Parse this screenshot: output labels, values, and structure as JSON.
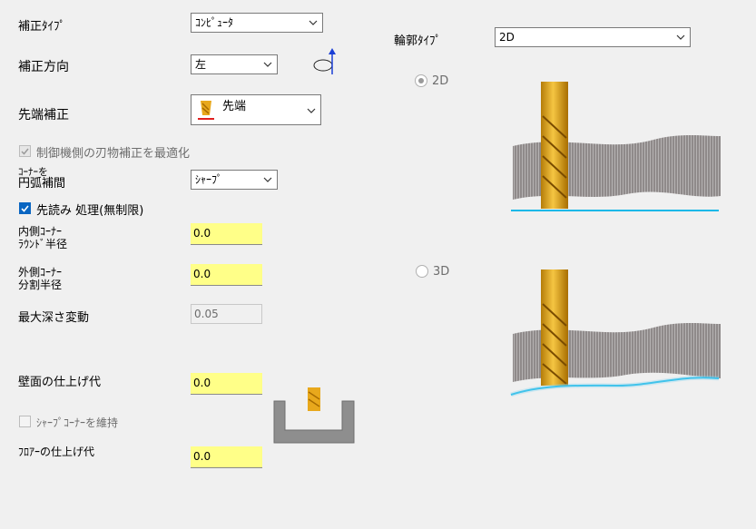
{
  "correction_type": {
    "label": "補正ﾀｲﾌﾟ",
    "value": "ｺﾝﾋﾟｭｰﾀ"
  },
  "correction_direction": {
    "label": "補正方向",
    "value": "左"
  },
  "tip_correction": {
    "label": "先端補正",
    "value": "先端"
  },
  "optimize_wear": {
    "label": "制御機側の刃物補正を最適化",
    "checked": true,
    "disabled": true
  },
  "corner_arc": {
    "label_line1": "ｺｰﾅｰを",
    "label_line2": "円弧補間",
    "value": "ｼｬｰﾌﾟ"
  },
  "lookahead": {
    "label": "先読み 処理(無制限)",
    "checked": true
  },
  "inner_corner": {
    "label_line1": "内側ｺｰﾅｰ",
    "label_line2": "ﾗｳﾝﾄﾞ半径",
    "value": "0.0"
  },
  "outer_corner": {
    "label_line1": "外側ｺｰﾅｰ",
    "label_line2": "分割半径",
    "value": "0.0"
  },
  "max_depth_variation": {
    "label": "最大深さ変動",
    "value": "0.05"
  },
  "wall_stock": {
    "label": "壁面の仕上げ代",
    "value": "0.0"
  },
  "keep_sharp_corner": {
    "label": "ｼｬｰﾌﾟｺｰﾅｰを維持",
    "checked": false,
    "disabled": true
  },
  "floor_stock": {
    "label": "ﾌﾛｱｰの仕上げ代",
    "value": "0.0"
  },
  "contour_type": {
    "label": "輪郭ﾀｲﾌﾟ",
    "value": "2D"
  },
  "radio_2d": {
    "label": "2D",
    "selected": true,
    "disabled": true
  },
  "radio_3d": {
    "label": "3D",
    "selected": false,
    "disabled": true
  },
  "colors": {
    "input_highlight": "#ffff88",
    "check_blue": "#0a66c2",
    "tool_gold": "#e8a81c",
    "path_cyan": "#17b8e8"
  },
  "icons": [
    "chevron-down-icon",
    "direction-loop-icon",
    "tool-tip-icon",
    "check-icon",
    "tool-2d-illustration",
    "tool-3d-illustration",
    "pocket-wall-illustration"
  ]
}
